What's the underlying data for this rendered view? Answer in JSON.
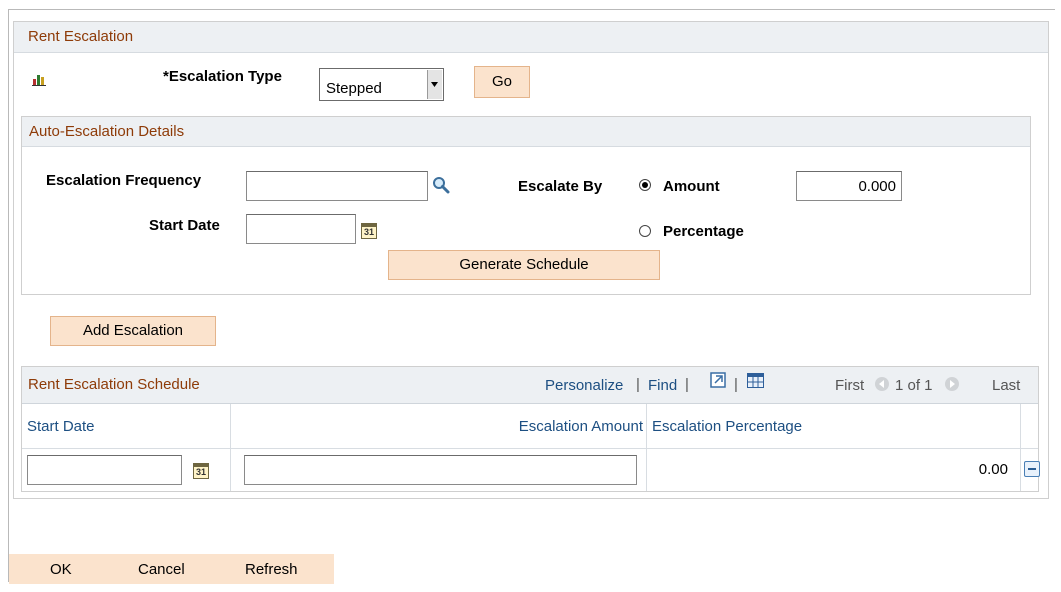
{
  "rent_escalation": {
    "title": "Rent Escalation",
    "escalation_type_label": "*Escalation Type",
    "escalation_type_value": "Stepped",
    "go_label": "Go"
  },
  "auto_escalation": {
    "title": "Auto-Escalation Details",
    "frequency_label": "Escalation Frequency",
    "frequency_value": "",
    "start_date_label": "Start Date",
    "start_date_value": "",
    "escalate_by_label": "Escalate By",
    "amount_label": "Amount",
    "amount_value": "0.000",
    "percentage_label": "Percentage",
    "selected_option": "Amount",
    "generate_label": "Generate Schedule"
  },
  "add_escalation_label": "Add Escalation",
  "schedule": {
    "title": "Rent Escalation Schedule",
    "personalize": "Personalize",
    "find": "Find",
    "first": "First",
    "range": "1 of 1",
    "last": "Last",
    "columns": [
      "Start Date",
      "Escalation Amount",
      "Escalation Percentage"
    ],
    "rows": [
      {
        "start_date": "",
        "escalation_amount": "",
        "escalation_percentage": "0.00"
      }
    ]
  },
  "footer": {
    "ok": "OK",
    "cancel": "Cancel",
    "refresh": "Refresh"
  },
  "colors": {
    "accent_button": "#fbe3cd",
    "header_text": "#8e3b08",
    "link": "#1d4f82"
  }
}
